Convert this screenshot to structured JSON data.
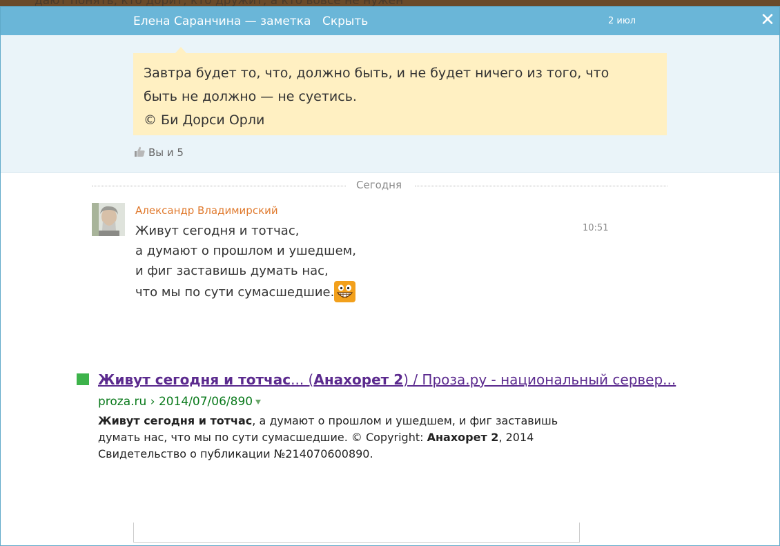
{
  "background": {
    "partial_text": "дают понять, кто дорит, кто дружит, а кто вовсе не нужен"
  },
  "topbar": {
    "title": "Елена Саранчина — заметка",
    "hide_label": "Скрыть",
    "date": "2 июл",
    "close_icon": "close-icon",
    "color": "#6ab6d8"
  },
  "note": {
    "lines": [
      "Завтра будет то, что, должно быть, и не будет ничего из того, что",
      "быть не должно — не суетись.",
      "© Би Дорси Орли"
    ],
    "bubble_color": "#fff0c2",
    "likes_icon": "thumbs-up-icon",
    "likes_text": "Вы и 5"
  },
  "separator": {
    "label": "Сегодня"
  },
  "comment": {
    "author": "Александр Владимирский",
    "author_color": "#e07a2e",
    "time": "10:51",
    "lines": [
      "Живут сегодня и тотчас,",
      "а думают о прошлом и ушедшем,",
      "и фиг заставишь думать нас,",
      "что мы по сути сумасшедшие."
    ],
    "emoji_icon": "grinning-smiley-icon"
  },
  "search_result": {
    "title_bold_1": "Живут сегодня и тотчас",
    "title_plain_1": "... (",
    "title_bold_2": "Анахорет 2",
    "title_plain_2": ") / Проза.ру - национальный сервер...",
    "url_domain": "proza.ru",
    "url_sep": " › ",
    "url_path": "2014/07/06/890",
    "snippet_bold_1": "Живут сегодня и тотчас",
    "snippet_plain_1": ", а думают о прошлом и ушедшем, и фиг заставишь",
    "snippet_line2_plain": "думать нас, что мы по сути сумасшедшие. © Copyright: ",
    "snippet_bold_2": "Анахорет 2",
    "snippet_line2_tail": ", 2014",
    "snippet_line3": "Свидетельство о публикации №214070600890.",
    "marker_color": "#3db34b"
  }
}
